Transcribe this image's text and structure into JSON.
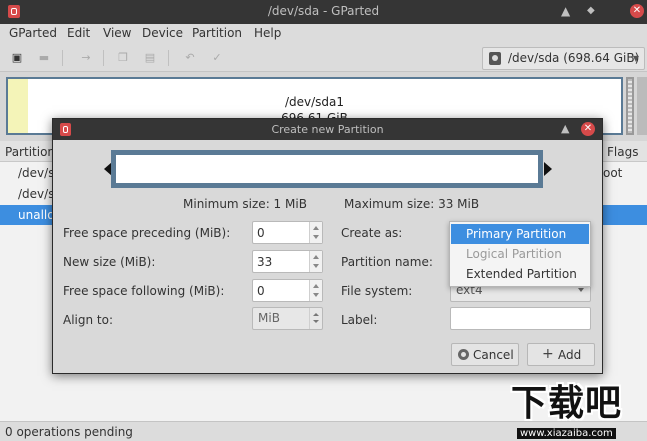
{
  "window": {
    "title": "/dev/sda - GParted",
    "minimize_glyph": "▲",
    "restore_glyph": "◆",
    "close_glyph": "✕"
  },
  "menubar": {
    "items": [
      "GParted",
      "Edit",
      "View",
      "Device",
      "Partition",
      "Help"
    ]
  },
  "toolbar": {
    "icons": [
      "new-icon",
      "delete-icon",
      "resize-move-icon",
      "copy-icon",
      "paste-icon",
      "undo-icon",
      "apply-icon"
    ],
    "device_selector": "/dev/sda  (698.64 GiB)"
  },
  "disk_map": {
    "partition_name": "/dev/sda1",
    "partition_size": "696.61 GiB"
  },
  "partition_table": {
    "columns": [
      "Partition",
      "Flags"
    ],
    "rows": [
      {
        "partition": "/dev/s",
        "flags": "oot",
        "selected": false
      },
      {
        "partition": "/dev/s",
        "flags": "",
        "selected": false
      },
      {
        "partition": "unallo",
        "flags": "",
        "selected": true
      }
    ]
  },
  "statusbar": {
    "text": "0 operations pending"
  },
  "dialog": {
    "title": "Create new Partition",
    "maximize_glyph": "▲",
    "close_glyph": "✕",
    "min_size": "Minimum size: 1 MiB",
    "max_size": "Maximum size: 33 MiB",
    "fields": {
      "free_preceding": {
        "label": "Free space preceding (MiB):",
        "value": "0"
      },
      "new_size": {
        "label": "New size (MiB):",
        "value": "33"
      },
      "free_following": {
        "label": "Free space following (MiB):",
        "value": "0"
      },
      "align_to": {
        "label": "Align to:",
        "value": "MiB"
      },
      "create_as": {
        "label": "Create as:"
      },
      "partition_name": {
        "label": "Partition name:"
      },
      "file_system": {
        "label": "File system:",
        "value": "ext4"
      },
      "label": {
        "label": "Label:",
        "value": ""
      }
    },
    "create_as_options": [
      {
        "label": "Primary Partition",
        "state": "highlighted"
      },
      {
        "label": "Logical Partition",
        "state": "disabled"
      },
      {
        "label": "Extended Partition",
        "state": "normal"
      }
    ],
    "buttons": {
      "cancel": "Cancel",
      "add": "Add"
    }
  },
  "watermark": {
    "text": "下载吧",
    "url": "www.xiazaiba.com"
  }
}
